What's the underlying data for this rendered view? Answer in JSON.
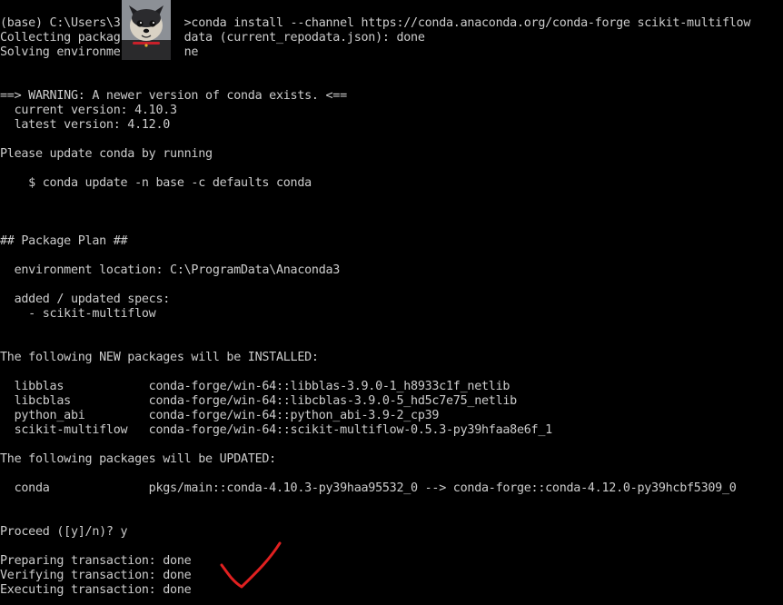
{
  "terminal": {
    "lines": [
      "(base) C:\\Users\\3         >conda install --channel https://conda.anaconda.org/conda-forge scikit-multiflow",
      "Collecting packag         data (current_repodata.json): done",
      "Solving environme         ne",
      "",
      "",
      "==> WARNING: A newer version of conda exists. <==",
      "  current version: 4.10.3",
      "  latest version: 4.12.0",
      "",
      "Please update conda by running",
      "",
      "    $ conda update -n base -c defaults conda",
      "",
      "",
      "",
      "## Package Plan ##",
      "",
      "  environment location: C:\\ProgramData\\Anaconda3",
      "",
      "  added / updated specs:",
      "    - scikit-multiflow",
      "",
      "",
      "The following NEW packages will be INSTALLED:",
      "",
      "  libblas            conda-forge/win-64::libblas-3.9.0-1_h8933c1f_netlib",
      "  libcblas           conda-forge/win-64::libcblas-3.9.0-5_hd5c7e75_netlib",
      "  python_abi         conda-forge/win-64::python_abi-3.9-2_cp39",
      "  scikit-multiflow   conda-forge/win-64::scikit-multiflow-0.5.3-py39hfaa8e6f_1",
      "",
      "The following packages will be UPDATED:",
      "",
      "  conda              pkgs/main::conda-4.10.3-py39haa95532_0 --> conda-forge::conda-4.12.0-py39hcbf5309_0",
      "",
      "",
      "Proceed ([y]/n)? y",
      "",
      "Preparing transaction: done",
      "Verifying transaction: done",
      "Executing transaction: done"
    ]
  },
  "colors": {
    "background": "#000000",
    "text": "#cccccc",
    "checkmark": "#e02020"
  },
  "overlay": {
    "avatar_icon": "dog-avatar-icon",
    "check_icon": "red-checkmark-icon"
  }
}
